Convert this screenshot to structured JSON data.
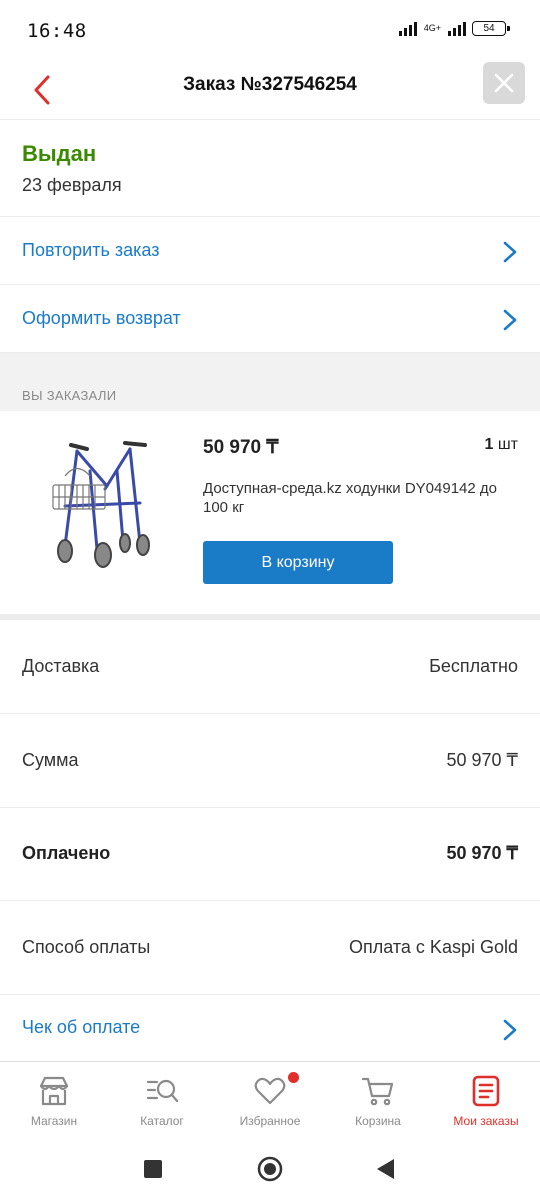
{
  "status_bar": {
    "time": "16:48",
    "network": "4G+",
    "battery": "54"
  },
  "header": {
    "title": "Заказ №327546254",
    "back_icon": "chevron-left-icon",
    "close_icon": "close-icon"
  },
  "order": {
    "status": "Выдан",
    "date": "23 февраля",
    "status_color": "#3a8a00"
  },
  "actions": {
    "repeat": "Повторить заказ",
    "return": "Оформить возврат"
  },
  "section_title": "ВЫ ЗАКАЗАЛИ",
  "product": {
    "price": "50 970 ₸",
    "qty_number": "1",
    "qty_unit": "шт",
    "name": "Доступная-среда.kz ходунки DY049142 до 100 кг",
    "cart_button": "В корзину"
  },
  "summary": [
    {
      "key": "Доставка",
      "value": "Бесплатно"
    },
    {
      "key": "Сумма",
      "value": "50 970 ₸"
    },
    {
      "key": "Оплачено",
      "value": "50 970 ₸"
    },
    {
      "key": "Способ оплаты",
      "value": "Оплата с Kaspi Gold"
    }
  ],
  "receipt_link": "Чек об оплате",
  "bottom_nav": [
    {
      "label": "Магазин",
      "icon": "store-icon"
    },
    {
      "label": "Каталог",
      "icon": "catalog-search-icon"
    },
    {
      "label": "Избранное",
      "icon": "heart-icon"
    },
    {
      "label": "Корзина",
      "icon": "cart-icon"
    },
    {
      "label": "Мои заказы",
      "icon": "orders-icon"
    }
  ],
  "colors": {
    "accent_blue": "#1a7bc7",
    "accent_red": "#e02f2a",
    "status_green": "#3a8a00"
  }
}
